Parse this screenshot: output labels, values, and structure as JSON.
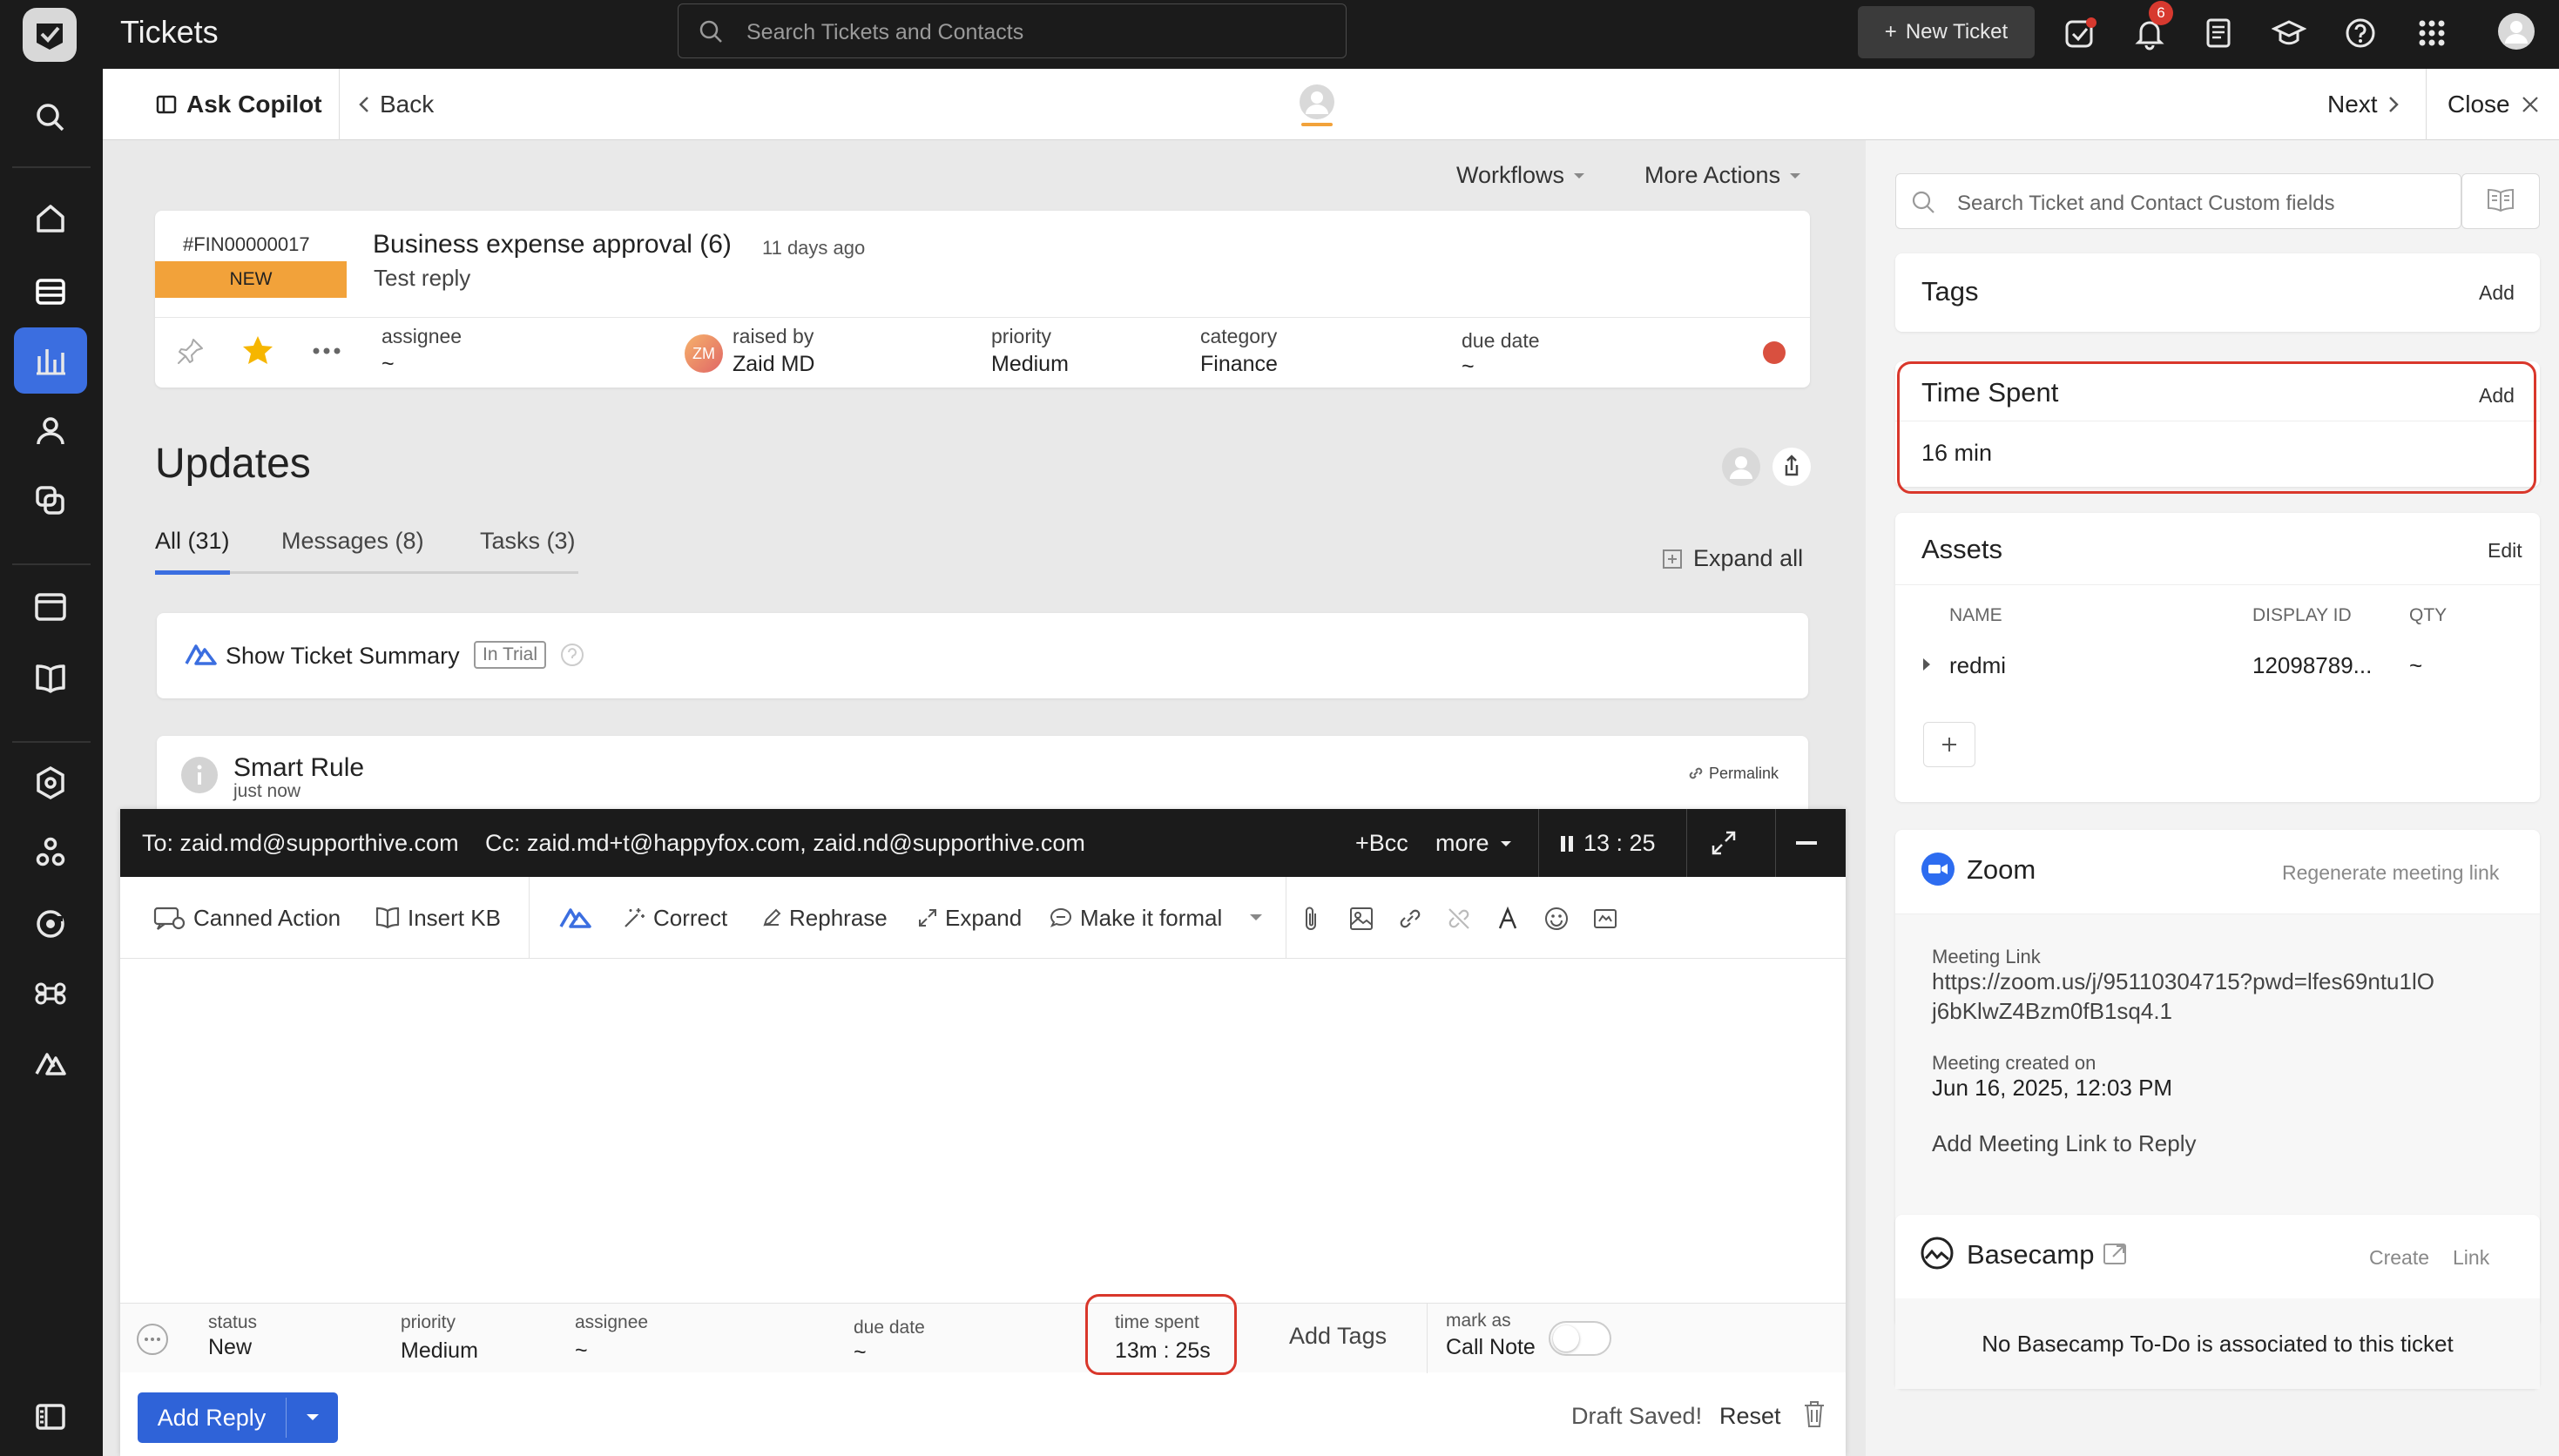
{
  "app": {
    "title": "Tickets"
  },
  "topbar": {
    "search_placeholder": "Search Tickets and Contacts",
    "new_ticket_label": "New Ticket",
    "notification_count": "6"
  },
  "subheader": {
    "copilot_label": "Ask Copilot",
    "back_label": "Back",
    "next_label": "Next",
    "close_label": "Close"
  },
  "actions": {
    "workflows_label": "Workflows",
    "more_actions_label": "More Actions"
  },
  "ticket": {
    "id": "#FIN00000017",
    "status_badge": "NEW",
    "subject": "Business expense approval",
    "count": "(6)",
    "age": "11 days ago",
    "last_message": "Test reply",
    "fields": {
      "assignee_label": "assignee",
      "assignee_value": "~",
      "raised_by_label": "raised by",
      "raised_by_value": "Zaid MD",
      "raised_by_initials": "ZM",
      "priority_label": "priority",
      "priority_value": "Medium",
      "category_label": "category",
      "category_value": "Finance",
      "due_date_label": "due date",
      "due_date_value": "~"
    },
    "status_dot_color": "#d9503f",
    "badge_color": "#f2a23a"
  },
  "updates": {
    "heading": "Updates",
    "tabs": [
      {
        "label": "All (31)",
        "active": true
      },
      {
        "label": "Messages (8)",
        "active": false
      },
      {
        "label": "Tasks (3)",
        "active": false
      }
    ],
    "expand_all_label": "Expand all",
    "summary_label": "Show Ticket Summary",
    "trial_badge": "In Trial",
    "smart_rule_title": "Smart Rule",
    "smart_rule_time": "just now",
    "permalink_label": "Permalink"
  },
  "composer": {
    "to_text": "To: zaid.md@supporthive.com",
    "cc_text": "Cc: zaid.md+t@happyfox.com, zaid.nd@supporthive.com",
    "bcc_label": "+Bcc",
    "more_label": "more",
    "timer": "13 : 25",
    "tools": {
      "canned_action": "Canned Action",
      "insert_kb": "Insert KB",
      "correct": "Correct",
      "rephrase": "Rephrase",
      "expand": "Expand",
      "make_formal": "Make it formal"
    },
    "footer": {
      "status_label": "status",
      "status_value": "New",
      "priority_label": "priority",
      "priority_value": "Medium",
      "assignee_label": "assignee",
      "assignee_value": "~",
      "due_date_label": "due date",
      "due_date_value": "~",
      "time_spent_label": "time spent",
      "time_spent_value": "13m : 25s",
      "add_tags_label": "Add Tags",
      "mark_as_label": "mark as",
      "call_note_label": "Call Note"
    },
    "add_reply_label": "Add Reply",
    "draft_saved_label": "Draft Saved!",
    "reset_label": "Reset"
  },
  "right_panel": {
    "search_placeholder": "Search Ticket and Contact Custom fields",
    "tags": {
      "title": "Tags",
      "add_label": "Add"
    },
    "time_spent": {
      "title": "Time Spent",
      "add_label": "Add",
      "value": "16 min"
    },
    "assets": {
      "title": "Assets",
      "edit_label": "Edit",
      "columns": [
        "NAME",
        "DISPLAY ID",
        "QTY"
      ],
      "rows": [
        {
          "name": "redmi",
          "display_id": "12098789...",
          "qty": "~"
        }
      ]
    },
    "zoom": {
      "title": "Zoom",
      "regenerate_label": "Regenerate meeting link",
      "meeting_link_label": "Meeting Link",
      "meeting_link_line1": "https://zoom.us/j/95110304715?pwd=lfes69ntu1lO",
      "meeting_link_line2": "j6bKlwZ4Bzm0fB1sq4.1",
      "created_label": "Meeting created on",
      "created_value": "Jun 16, 2025, 12:03 PM",
      "add_link_label": "Add Meeting Link to Reply"
    },
    "basecamp": {
      "title": "Basecamp",
      "create_label": "Create",
      "link_label": "Link",
      "empty_message": "No Basecamp To-Do is associated to this ticket"
    }
  },
  "colors": {
    "accent": "#3b6ee0",
    "highlight": "#d9372b",
    "dark": "#1b1b1b"
  }
}
